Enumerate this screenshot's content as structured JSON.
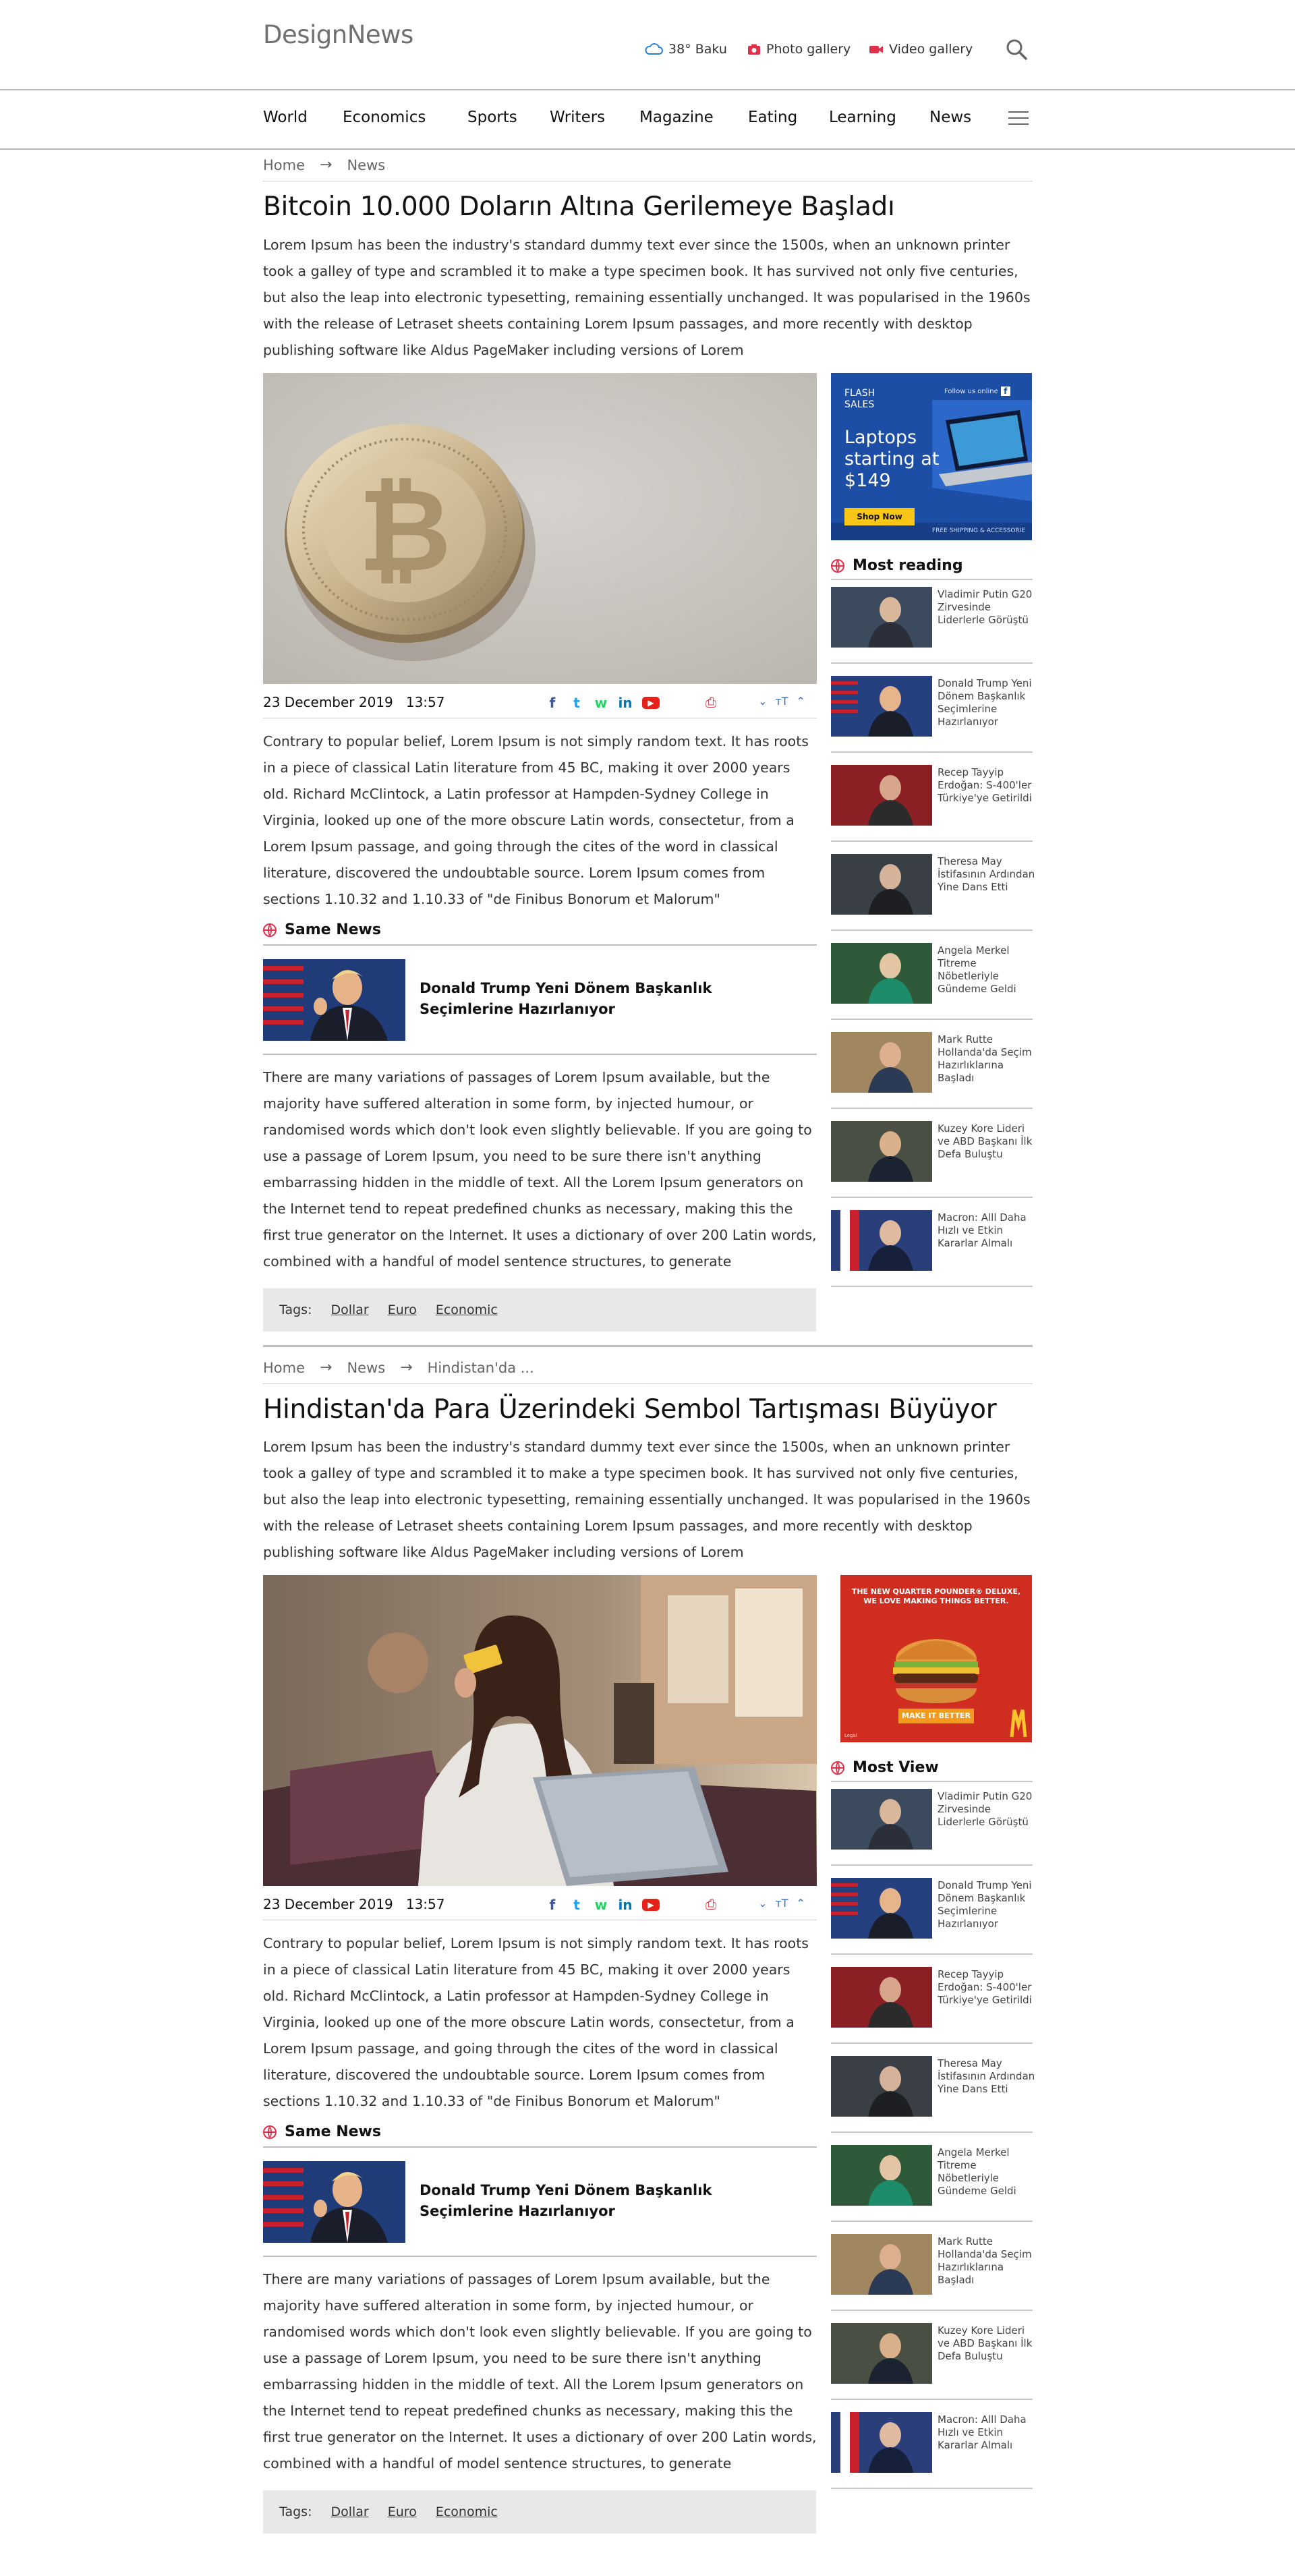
{
  "header": {
    "logo": "DesignNews",
    "weather": "38° Baku",
    "photo_gallery": "Photo gallery",
    "video_gallery": "Video gallery"
  },
  "nav": {
    "items": [
      "World",
      "Economics",
      "Sports",
      "Writers",
      "Magazine",
      "Eating",
      "Learning",
      "News"
    ]
  },
  "share_icons": {
    "facebook": "f",
    "twitter": "t",
    "whatsapp": "w",
    "linkedin": "in",
    "youtube": "▶",
    "print": "⎙"
  },
  "articles": [
    {
      "breadcrumb": [
        "Home",
        "News"
      ],
      "title": "Bitcoin 10.000 Doların Altına Gerilemeye Başladı",
      "intro": "Lorem Ipsum has been the industry's standard dummy text ever since the 1500s, when an unknown printer took a galley of type and scrambled it to make a type specimen book. It has survived not only five centuries, but also the leap into electronic typesetting, remaining essentially unchanged. It was popularised in the 1960s with the release of Letraset sheets containing Lorem Ipsum passages, and more recently with desktop publishing software like Aldus PageMaker including versions of Lorem",
      "date": "23 December 2019",
      "time": "13:57",
      "body1": "Contrary to popular belief, Lorem Ipsum is not simply random text. It has roots in a piece of classical Latin literature from 45 BC, making it over 2000 years old. Richard McClintock, a Latin professor at Hampden-Sydney College in Virginia, looked up one of the more obscure Latin words, consectetur, from a Lorem Ipsum passage, and going through the cites of the word in classical literature, discovered the undoubtable source. Lorem Ipsum comes from sections 1.10.32 and 1.10.33 of \"de Finibus Bonorum et Malorum\"",
      "same_news_heading": "Same News",
      "same_news_title": "Donald Trump Yeni Dönem Başkanlık Seçimlerine Hazırlanıyor",
      "body2": "There are many variations of passages of Lorem Ipsum available, but the majority have suffered alteration in some form, by injected humour, or randomised words which don't look even slightly believable. If you are going to use a passage of Lorem Ipsum, you need to be sure there isn't anything embarrassing hidden in the middle of text. All the Lorem Ipsum generators on the Internet tend to repeat predefined chunks as necessary, making this the first true generator on the Internet. It uses a dictionary of over 200 Latin words, combined with a handful of model sentence structures, to generate",
      "tags_label": "Tags:",
      "tags": [
        "Dollar",
        "Euro",
        "Economic"
      ]
    },
    {
      "breadcrumb": [
        "Home",
        "News",
        "Hindistan'da ..."
      ],
      "title": "Hindistan'da Para Üzerindeki Sembol Tartışması Büyüyor",
      "intro": "Lorem Ipsum has been the industry's standard dummy text ever since the 1500s, when an unknown printer took a galley of type and scrambled it to make a type specimen book. It has survived not only five centuries, but also the leap into electronic typesetting, remaining essentially unchanged. It was popularised in the 1960s with the release of Letraset sheets containing Lorem Ipsum passages, and more recently with desktop publishing software like Aldus PageMaker including versions of Lorem",
      "date": "23 December 2019",
      "time": "13:57",
      "body1": "Contrary to popular belief, Lorem Ipsum is not simply random text. It has roots in a piece of classical Latin literature from 45 BC, making it over 2000 years old. Richard McClintock, a Latin professor at Hampden-Sydney College in Virginia, looked up one of the more obscure Latin words, consectetur, from a Lorem Ipsum passage, and going through the cites of the word in classical literature, discovered the undoubtable source. Lorem Ipsum comes from sections 1.10.32 and 1.10.33 of \"de Finibus Bonorum et Malorum\"",
      "same_news_heading": "Same News",
      "same_news_title": "Donald Trump Yeni Dönem Başkanlık Seçimlerine Hazırlanıyor",
      "body2": "There are many variations of passages of Lorem Ipsum available, but the majority have suffered alteration in some form, by injected humour, or randomised words which don't look even slightly believable. If you are going to use a passage of Lorem Ipsum, you need to be sure there isn't anything embarrassing hidden in the middle of text. All the Lorem Ipsum generators on the Internet tend to repeat predefined chunks as necessary, making this the first true generator on the Internet. It uses a dictionary of over 200 Latin words, combined with a handful of model sentence structures, to generate",
      "tags_label": "Tags:",
      "tags": [
        "Dollar",
        "Euro",
        "Economic"
      ]
    }
  ],
  "ad_laptop": {
    "flash": "FLASH",
    "sales": "SALES",
    "follow": "Follow us online",
    "line1": "Laptops",
    "line2": "starting at",
    "line3": "$149",
    "cta": "Shop Now",
    "footer": "FREE SHIPPING & ACCESSORIE"
  },
  "ad_burger": {
    "headline1": "THE NEW QUARTER POUNDER® DELUXE,",
    "headline2": "WE LOVE MAKING THINGS BETTER.",
    "cta": "MAKE IT BETTER",
    "small": "Legal"
  },
  "sidebars": [
    {
      "heading": "Most reading",
      "items": [
        "Vladimir Putin G20 Zirvesinde Liderlerle Görüştü",
        "Donald Trump Yeni Dönem Başkanlık Seçimlerine Hazırlanıyor",
        "Recep Tayyip Erdoğan: S-400'ler Türkiye'ye Getirildi",
        "Theresa May İstifasının Ardından Yine Dans Etti",
        "Angela Merkel Titreme Nöbetleriyle Gündeme Geldi",
        "Mark Rutte Hollanda'da Seçim Hazırlıklarına Başladı",
        "Kuzey Kore Lideri ve ABD Başkanı İlk Defa Buluştu",
        "Macron: Alll Daha Hızlı ve Etkin Kararlar Almalı"
      ]
    },
    {
      "heading": "Most View",
      "items": [
        "Vladimir Putin G20 Zirvesinde Liderlerle Görüştü",
        "Donald Trump Yeni Dönem Başkanlık Seçimlerine Hazırlanıyor",
        "Recep Tayyip Erdoğan: S-400'ler Türkiye'ye Getirildi",
        "Theresa May İstifasının Ardından Yine Dans Etti",
        "Angela Merkel Titreme Nöbetleriyle Gündeme Geldi",
        "Mark Rutte Hollanda'da Seçim Hazırlıklarına Başladı",
        "Kuzey Kore Lideri ve ABD Başkanı İlk Defa Buluştu",
        "Macron: Alll Daha Hızlı ve Etkin Kararlar Almalı"
      ]
    }
  ],
  "colors": {
    "accent": "#e0314a",
    "facebook": "#3b5998",
    "twitter": "#1da1f2",
    "whatsapp": "#25d366",
    "linkedin": "#0077b5",
    "youtube": "#e62117",
    "weather": "#2a7fd4"
  }
}
